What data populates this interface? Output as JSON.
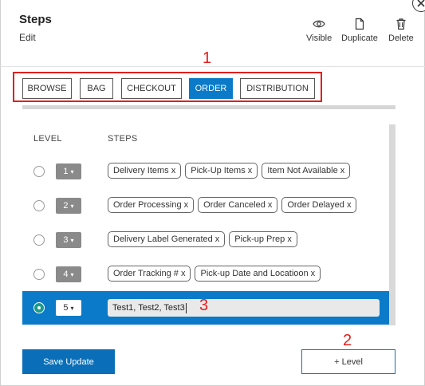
{
  "header": {
    "title": "Steps",
    "subtitle": "Edit",
    "actions": [
      {
        "label": "Visible",
        "icon": "eye-icon"
      },
      {
        "label": "Duplicate",
        "icon": "document-icon"
      },
      {
        "label": "Delete",
        "icon": "trash-icon"
      }
    ]
  },
  "annotations": [
    "1",
    "2",
    "3"
  ],
  "tabs": [
    {
      "label": "BROWSE",
      "active": false
    },
    {
      "label": "BAG",
      "active": false
    },
    {
      "label": "CHECKOUT",
      "active": false
    },
    {
      "label": "ORDER",
      "active": true
    },
    {
      "label": "DISTRIBUTION",
      "active": false
    }
  ],
  "table": {
    "col_level": "LEVEL",
    "col_steps": "STEPS",
    "rows": [
      {
        "level": "1",
        "selected": false,
        "steps": [
          "Delivery Items x",
          "Pick-Up Items x",
          "Item Not Available x"
        ]
      },
      {
        "level": "2",
        "selected": false,
        "steps": [
          "Order Processing x",
          "Order Canceled x",
          "Order Delayed x"
        ]
      },
      {
        "level": "3",
        "selected": false,
        "steps": [
          "Delivery Label Generated x",
          "Pick-up Prep x"
        ]
      },
      {
        "level": "4",
        "selected": false,
        "steps": [
          "Order Tracking # x",
          "Pick-up Date and Locatioon x"
        ]
      },
      {
        "level": "5",
        "selected": true,
        "input_value": "Test1, Test2, Test3"
      }
    ]
  },
  "buttons": {
    "save": "Save Update",
    "add_level": "+ Level"
  },
  "colors": {
    "accent": "#0a7ac9",
    "annotation": "#e0201c"
  }
}
